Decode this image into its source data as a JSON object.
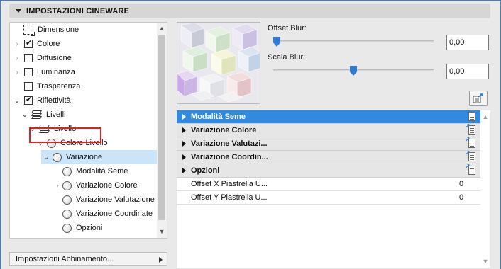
{
  "header": {
    "title": "IMPOSTAZIONI CINEWARE"
  },
  "tree": {
    "items": [
      {
        "label": "Dimensione"
      },
      {
        "label": "Colore"
      },
      {
        "label": "Diffusione"
      },
      {
        "label": "Luminanza"
      },
      {
        "label": "Trasparenza"
      },
      {
        "label": "Riflettività"
      },
      {
        "label": "Livelli"
      },
      {
        "label": "Livello"
      },
      {
        "label": "Colore Livello"
      },
      {
        "label": "Variazione"
      },
      {
        "label": "Modalità Seme"
      },
      {
        "label": "Variazione Colore"
      },
      {
        "label": "Variazione Valutazione"
      },
      {
        "label": "Variazione Coordinate"
      },
      {
        "label": "Opzioni"
      }
    ],
    "up_arrow": "▲",
    "down_arrow": "▼"
  },
  "bottom_button": {
    "label": "Impostazioni Abbinamento..."
  },
  "sliders": {
    "offset_blur": {
      "label": "Offset Blur:",
      "value": "0,00",
      "level": 0.0
    },
    "scala_blur": {
      "label": "Scala Blur:",
      "value": "0,00",
      "level": 0.5
    }
  },
  "properties": {
    "groups": [
      {
        "label": "Modalità Seme",
        "active": true
      },
      {
        "label": "Variazione Colore",
        "active": false
      },
      {
        "label": "Variazione Valutazi...",
        "active": false
      },
      {
        "label": "Variazione Coordin...",
        "active": false
      },
      {
        "label": "Opzioni",
        "active": false
      }
    ],
    "params": [
      {
        "label": "Offset X Piastrella U...",
        "value": "0"
      },
      {
        "label": "Offset Y Piastrella U...",
        "value": "0"
      }
    ]
  },
  "icons": {
    "collapse": "triangle-down-icon",
    "check": "checkmark-icon",
    "material": "sphere-icon",
    "layers": "layers-icon",
    "dimension": "dimension-icon",
    "apply": "transfer-icon",
    "favorites": "favorites-icon"
  },
  "colors": {
    "accent": "#2f8ae0",
    "selection": "#cce4f7",
    "highlight_box": "#e02020"
  }
}
